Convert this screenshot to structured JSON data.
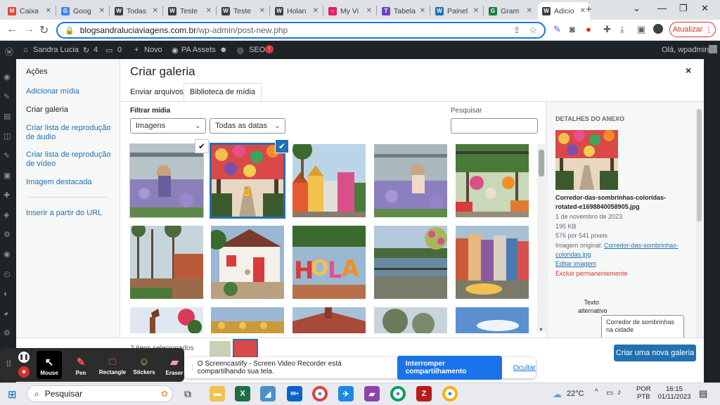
{
  "browser": {
    "tabs": [
      {
        "label": "Caixa",
        "icon": "gmail-icon",
        "color": "#ea4335",
        "glyph": "M"
      },
      {
        "label": "Goog",
        "icon": "google-docs-icon",
        "color": "#4285f4",
        "glyph": "G"
      },
      {
        "label": "Todas",
        "icon": "wordpress-icon",
        "color": "#3c4043",
        "glyph": "W"
      },
      {
        "label": "Teste",
        "icon": "wordpress-icon",
        "color": "#3c4043",
        "glyph": "W"
      },
      {
        "label": "Teste",
        "icon": "wordpress-icon",
        "color": "#3c4043",
        "glyph": "W"
      },
      {
        "label": "Holan",
        "icon": "wordpress-icon",
        "color": "#3c4043",
        "glyph": "W"
      },
      {
        "label": "My Vi",
        "icon": "myvideo-icon",
        "color": "#e91e63",
        "glyph": "○"
      },
      {
        "label": "Tabela",
        "icon": "tabela-icon",
        "color": "#6f42c1",
        "glyph": "T"
      },
      {
        "label": "Painel",
        "icon": "wordpress-icon",
        "color": "#2271b1",
        "glyph": "W"
      },
      {
        "label": "Gram",
        "icon": "gram-icon",
        "color": "#15803d",
        "glyph": "G"
      },
      {
        "label": "Adicio",
        "icon": "wordpress-icon",
        "color": "#3c4043",
        "glyph": "W",
        "active": true
      }
    ],
    "url_domain": "blogsandraluciaviagens.com.br",
    "url_path": "/wp-admin/post-new.php",
    "update_label": "Atualizar"
  },
  "wpbar": {
    "site_name": "Sandra Lucia",
    "updates_count": "4",
    "comments_count": "0",
    "new_label": "Novo",
    "pa_label": "PA Assets",
    "seo_label": "SEO",
    "seo_badge": "!",
    "greeting": "Olá, wpadmin"
  },
  "modal": {
    "menu": {
      "heading": "Ações",
      "items": [
        "Adicionar mídia",
        "Criar galeria",
        "Criar lista de reprodução de áudio",
        "Criar lista de reprodução de vídeo",
        "Imagem destacada",
        "Inserir a partir do URL"
      ]
    },
    "title": "Criar galeria",
    "close_label": "×",
    "tabs": [
      "Enviar arquivos",
      "Biblioteca de mídia"
    ],
    "filter_label": "Filtrar mídia",
    "filter_type": "Imagens",
    "filter_date": "Todas as datas",
    "search_label": "Pesquisar",
    "selected_count": "2 itens selecionados",
    "create_button": "Criar uma nova galeria"
  },
  "details": {
    "heading": "Detalhes do anexo",
    "filename": "Corredor-das-sombrinhas-coloridas-rotated-e1698840058905.jpg",
    "date": "1 de novembro de 2023",
    "size": "195 KB",
    "dimensions": "576 por 541 píxeis",
    "original_label": "Imagem original:",
    "original_link": "Corredor-das-sombrinhas-coloridas.jpg",
    "edit_link": "Editar imagem",
    "delete_link": "Excluir permanentemente",
    "alt_label": "Texto alternativo",
    "alt_value": "Corredor de sombrinhas na cidade"
  },
  "screencastify": {
    "tools": [
      "Mouse",
      "Pen",
      "Rectangle",
      "Stickers",
      "Eraser"
    ],
    "notice": "O Screencastify - Screen Video Recorder está compartilhando sua tela.",
    "stop_button": "Interromper compartilhamento",
    "hide_link": "Ocultar"
  },
  "taskbar": {
    "search_placeholder": "Pesquisar",
    "weather": "22°C",
    "lang_top": "POR",
    "lang_bottom": "PTB",
    "time": "16:15",
    "date": "01/11/2023",
    "mail_badge": "99+"
  },
  "colors": {
    "wp_blue": "#2271b1",
    "wp_dark": "#1d2327",
    "chrome_blue": "#1a73e8",
    "danger": "#d63638"
  }
}
